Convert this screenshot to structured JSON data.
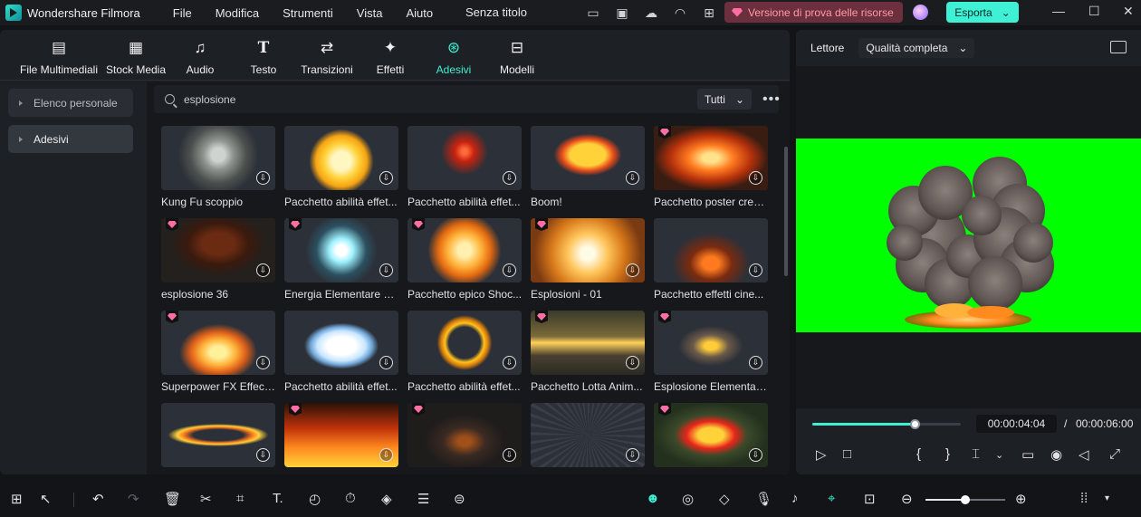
{
  "app": {
    "name": "Wondershare Filmora",
    "document_title": "Senza titolo",
    "menu": [
      "File",
      "Modifica",
      "Strumenti",
      "Vista",
      "Aiuto"
    ],
    "promo_label": "Versione di prova delle risorse",
    "export_label": "Esporta",
    "titlebar_icons": [
      "layout-icon",
      "save-icon",
      "cloud-upload-icon",
      "headset-icon",
      "apps-icon"
    ]
  },
  "toolbar": {
    "tabs": [
      {
        "label": "File Multimediali",
        "icon": "media-icon"
      },
      {
        "label": "Stock Media",
        "icon": "stock-icon"
      },
      {
        "label": "Audio",
        "icon": "music-icon"
      },
      {
        "label": "Testo",
        "icon": "text-icon"
      },
      {
        "label": "Transizioni",
        "icon": "transition-icon"
      },
      {
        "label": "Effetti",
        "icon": "effects-icon"
      },
      {
        "label": "Adesivi",
        "icon": "sticker-icon"
      },
      {
        "label": "Modelli",
        "icon": "template-icon"
      }
    ],
    "active_tab": "Adesivi"
  },
  "sidebar": {
    "items": [
      {
        "label": "Elenco personale"
      },
      {
        "label": "Adesivi"
      }
    ],
    "selected": "Adesivi"
  },
  "search": {
    "value": "esplosione",
    "filter_value": "Tutti"
  },
  "stickers": [
    {
      "label": "Kung Fu scoppio",
      "premium": false,
      "art": "smoke"
    },
    {
      "label": "Pacchetto abilità effet...",
      "premium": false,
      "art": "cartoon-cloud"
    },
    {
      "label": "Pacchetto abilità effet...",
      "premium": false,
      "art": "sparks"
    },
    {
      "label": "Boom!",
      "premium": false,
      "art": "boom"
    },
    {
      "label": "Pacchetto poster creat...",
      "premium": true,
      "art": "fireball"
    },
    {
      "label": "esplosione 36",
      "premium": true,
      "art": "mushroom"
    },
    {
      "label": "Energia Elementare 10...",
      "premium": true,
      "art": "energy"
    },
    {
      "label": "Pacchetto epico Shoc...",
      "premium": true,
      "art": "shock"
    },
    {
      "label": "Esplosioni - 01",
      "premium": true,
      "art": "flash"
    },
    {
      "label": "Pacchetto effetti cine...",
      "premium": false,
      "art": "cine"
    },
    {
      "label": "Superpower FX Effects...",
      "premium": true,
      "art": "flame"
    },
    {
      "label": "Pacchetto abilità effet...",
      "premium": false,
      "art": "white-cloud"
    },
    {
      "label": "Pacchetto abilità effet...",
      "premium": false,
      "art": "ring"
    },
    {
      "label": "Pacchetto Lotta Anim...",
      "premium": true,
      "art": "fight"
    },
    {
      "label": "Esplosione Elementare...",
      "premium": true,
      "art": "elemental"
    },
    {
      "label": "",
      "premium": false,
      "art": "fire-ring"
    },
    {
      "label": "",
      "premium": true,
      "art": "fire-wall"
    },
    {
      "label": "",
      "premium": true,
      "art": "dark-blast"
    },
    {
      "label": "",
      "premium": false,
      "art": "speed-lines"
    },
    {
      "label": "",
      "premium": true,
      "art": "wow"
    }
  ],
  "player": {
    "tab_label": "Lettore",
    "quality_label": "Qualità completa",
    "current_time": "00:00:04:04",
    "separator": "/",
    "total_time": "00:00:06:00",
    "progress": 0.69,
    "background_color": "#00ff00"
  },
  "bottom_bar": {
    "zoom_level": 0.5
  },
  "colors": {
    "accent": "#3ef0d4",
    "promo_bg": "#6b2f3e",
    "premium_gem": "#ff6fa3"
  }
}
